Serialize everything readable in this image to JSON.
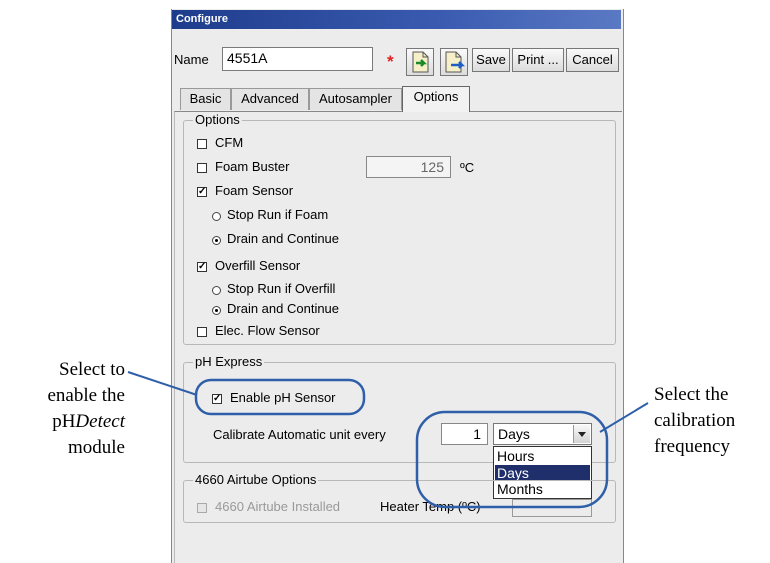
{
  "window": {
    "title": "Configure"
  },
  "header": {
    "name_label": "Name",
    "name_value": "4551A",
    "required_mark": "*"
  },
  "toolbar": {
    "save_label": "Save",
    "print_label": "Print ...",
    "cancel_label": "Cancel"
  },
  "tabs": [
    {
      "label": "Basic"
    },
    {
      "label": "Advanced"
    },
    {
      "label": "Autosampler"
    },
    {
      "label": "Options"
    }
  ],
  "options": {
    "group_title": "Options",
    "cfm_label": "CFM",
    "cfm_checked": false,
    "foam_buster_label": "Foam Buster",
    "foam_buster_checked": false,
    "foam_buster_value": "125",
    "foam_buster_unit": "ºC",
    "foam_sensor_label": "Foam Sensor",
    "foam_sensor_checked": true,
    "foam_stop_label": "Stop Run if Foam",
    "foam_drain_label": "Drain and Continue",
    "overfill_label": "Overfill Sensor",
    "overfill_checked": true,
    "overfill_stop_label": "Stop Run if Overfill",
    "overfill_drain_label": "Drain and Continue",
    "elec_flow_label": "Elec. Flow Sensor",
    "elec_flow_checked": false
  },
  "ph_express": {
    "group_title": "pH Express",
    "enable_label": "Enable pH Sensor",
    "enable_checked": true,
    "calibrate_label": "Calibrate Automatic unit every",
    "calibrate_value": "1",
    "unit_selected": "Days",
    "unit_options": [
      "Hours",
      "Days",
      "Months"
    ]
  },
  "airtube": {
    "group_title": "4660 Airtube Options",
    "installed_label": "4660 Airtube Installed",
    "heater_label": "Heater Temp (ºC)"
  },
  "callouts": {
    "left": [
      "Select to",
      "enable the",
      "pH",
      "Detect",
      "module"
    ],
    "right": [
      "Select the",
      "calibration",
      "frequency"
    ]
  },
  "colors": {
    "titlebar": "#1e3c8c",
    "callout_line": "#2f5fa8",
    "required": "#e02020",
    "selection": "#1f2f6b"
  }
}
